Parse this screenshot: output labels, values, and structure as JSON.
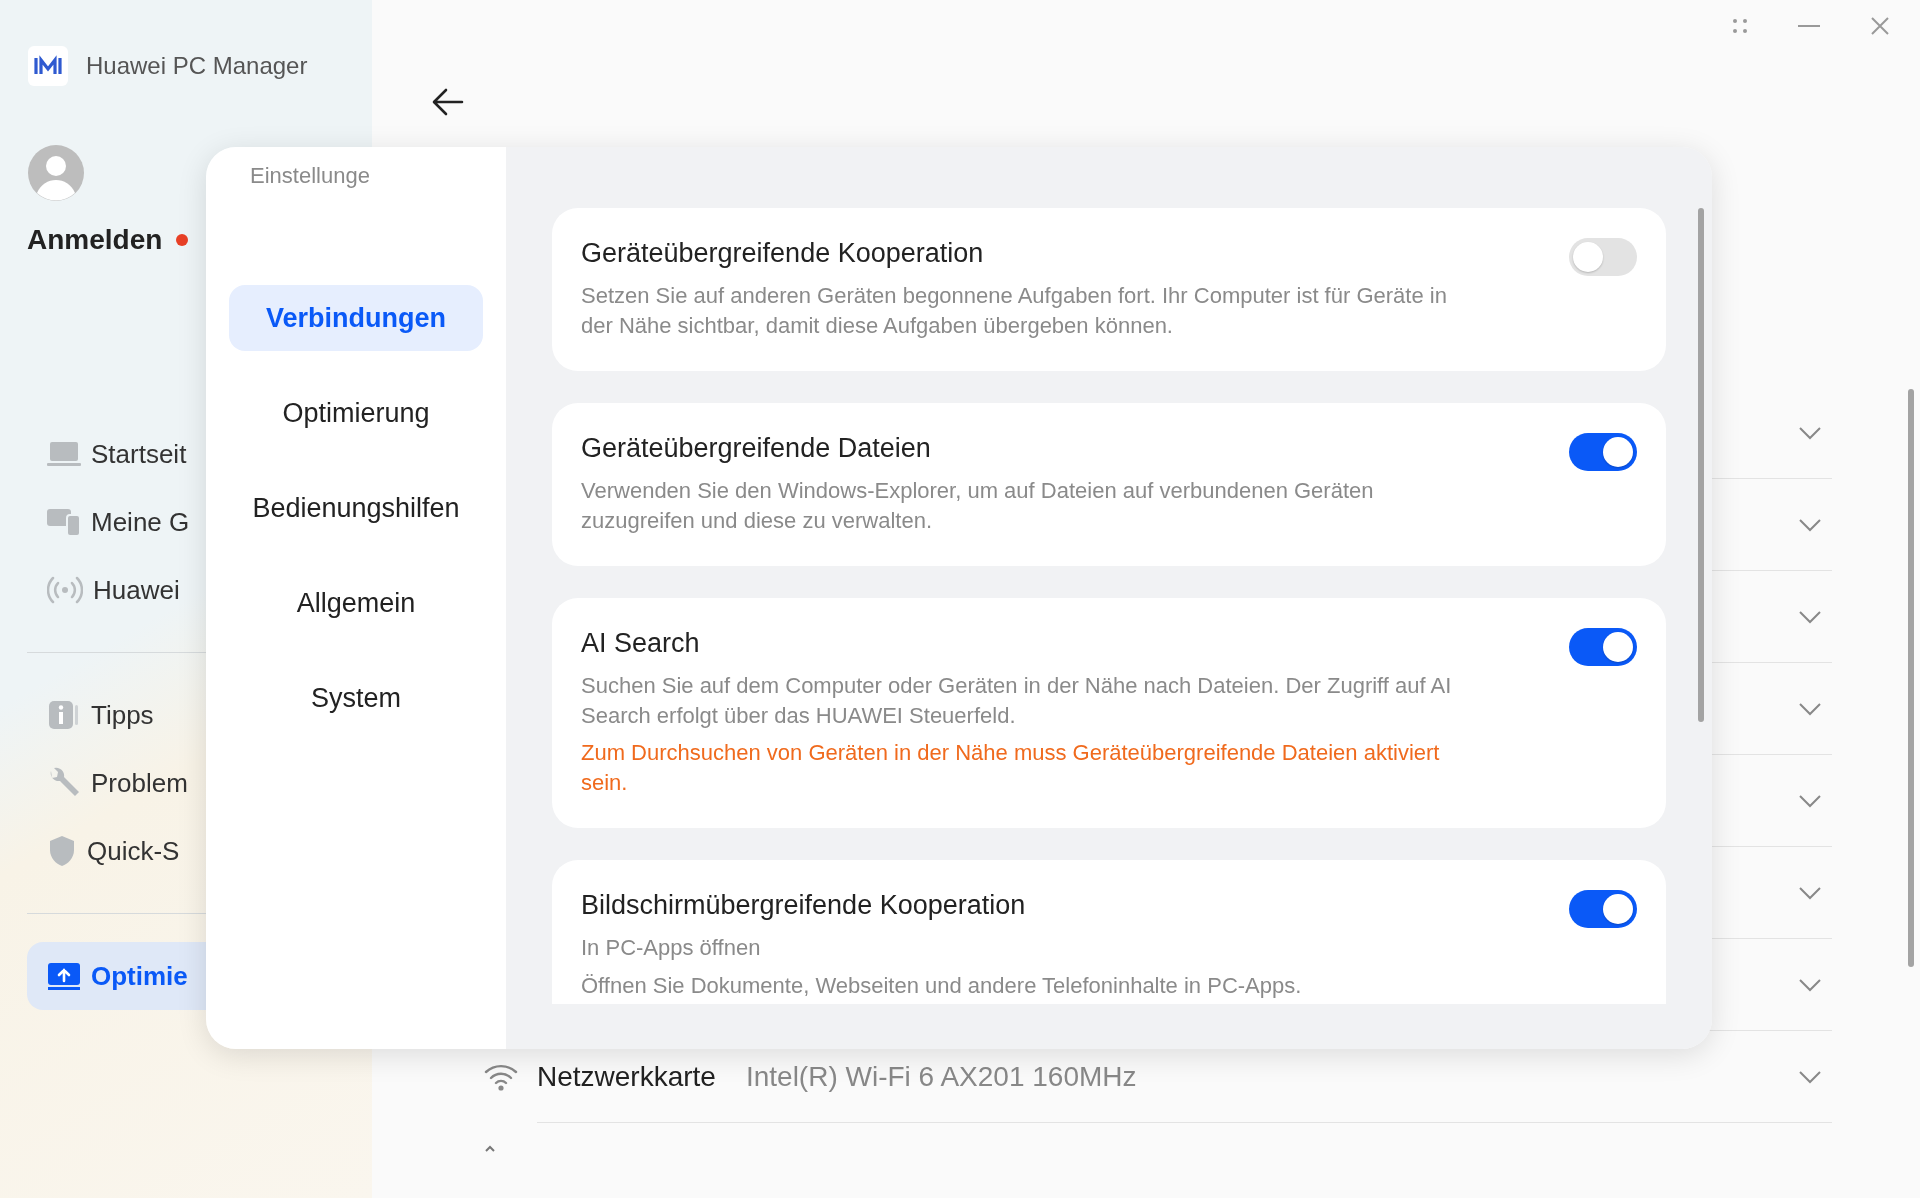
{
  "app": {
    "title": "Huawei PC Manager"
  },
  "account": {
    "label": "Anmelden",
    "notification": true
  },
  "sidebar": {
    "groups": [
      [
        {
          "label": "Startseit",
          "selected": false
        },
        {
          "label": "Meine G",
          "selected": false
        },
        {
          "label": "Huawei",
          "selected": false
        }
      ],
      [
        {
          "label": "Tipps",
          "selected": false
        },
        {
          "label": "Problem",
          "selected": false
        },
        {
          "label": "Quick-S",
          "selected": false
        }
      ],
      [
        {
          "label": "Optimie",
          "selected": true
        }
      ]
    ]
  },
  "settings": {
    "title": "Einstellunge",
    "nav": [
      {
        "label": "Verbindungen",
        "selected": true
      },
      {
        "label": "Optimierung",
        "selected": false
      },
      {
        "label": "Bedienungshilfen",
        "selected": false
      },
      {
        "label": "Allgemein",
        "selected": false
      },
      {
        "label": "System",
        "selected": false
      }
    ],
    "cards": [
      {
        "title": "Geräteübergreifende Kooperation",
        "description": "Setzen Sie auf anderen Geräten begonnene Aufgaben fort. Ihr Computer ist für Geräte in der Nähe sichtbar, damit diese Aufgaben übergeben können.",
        "on": false
      },
      {
        "title": "Geräteübergreifende Dateien",
        "description": "Verwenden Sie den Windows-Explorer, um auf Dateien auf verbundenen Geräten zuzugreifen und diese zu verwalten.",
        "on": true
      },
      {
        "title": "AI Search",
        "description": "Suchen Sie auf dem Computer oder Geräten in der Nähe nach Dateien. Der Zugriff auf AI Search erfolgt über das HUAWEI Steuerfeld.",
        "note": "Zum Durchsuchen von Geräten in der Nähe muss Geräteübergreifende Dateien aktiviert sein.",
        "on": true
      },
      {
        "title": "Bildschirmübergreifende Kooperation",
        "subtitle": "In PC-Apps öffnen",
        "description": "Öffnen Sie Dokumente, Webseiten und andere Telefoninhalte in PC-Apps.",
        "on": true
      }
    ]
  },
  "device_rows": [
    {
      "expanded": false
    },
    {
      "expanded": false
    },
    {
      "expanded": false
    },
    {
      "expanded": false
    },
    {
      "expanded": false
    },
    {
      "expanded": false
    },
    {
      "expanded": false
    },
    {
      "label": "Netzwerkkarte",
      "value": "Intel(R) Wi-Fi 6 AX201 160MHz",
      "expanded": false
    }
  ]
}
